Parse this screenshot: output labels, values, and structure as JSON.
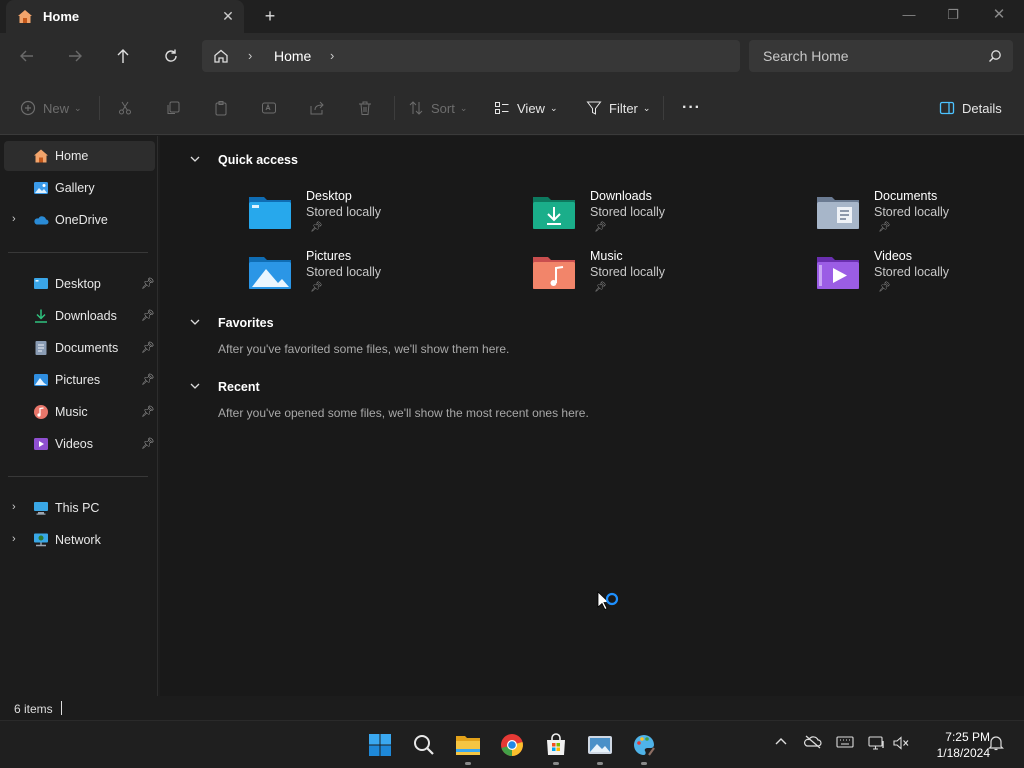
{
  "window": {
    "tab_title": "Home",
    "new_tab": "+"
  },
  "nav": {
    "breadcrumb": "Home",
    "search_placeholder": "Search Home"
  },
  "toolbar": {
    "new_label": "New",
    "sort_label": "Sort",
    "view_label": "View",
    "filter_label": "Filter",
    "more_label": "···",
    "details_label": "Details"
  },
  "sidebar": {
    "items": [
      {
        "label": "Home",
        "icon": "home-icon"
      },
      {
        "label": "Gallery",
        "icon": "gallery-icon"
      },
      {
        "label": "OneDrive",
        "icon": "onedrive-icon"
      },
      {
        "label": "Desktop",
        "icon": "desktop-icon"
      },
      {
        "label": "Downloads",
        "icon": "downloads-icon"
      },
      {
        "label": "Documents",
        "icon": "documents-icon"
      },
      {
        "label": "Pictures",
        "icon": "pictures-icon"
      },
      {
        "label": "Music",
        "icon": "music-icon"
      },
      {
        "label": "Videos",
        "icon": "videos-icon"
      },
      {
        "label": "This PC",
        "icon": "this-pc-icon"
      },
      {
        "label": "Network",
        "icon": "network-icon"
      }
    ]
  },
  "main": {
    "quick_access_title": "Quick access",
    "quick_access": [
      {
        "name": "Desktop",
        "sub": "Stored locally"
      },
      {
        "name": "Downloads",
        "sub": "Stored locally"
      },
      {
        "name": "Documents",
        "sub": "Stored locally"
      },
      {
        "name": "Pictures",
        "sub": "Stored locally"
      },
      {
        "name": "Music",
        "sub": "Stored locally"
      },
      {
        "name": "Videos",
        "sub": "Stored locally"
      }
    ],
    "favorites_title": "Favorites",
    "favorites_empty": "After you've favorited some files, we'll show them here.",
    "recent_title": "Recent",
    "recent_empty": "After you've opened some files, we'll show the most recent ones here."
  },
  "status": {
    "item_count": "6 items"
  },
  "taskbar": {
    "time": "7:25 PM",
    "date": "1/18/2024"
  },
  "colors": {
    "accent": "#4cc2ff",
    "folder_blue": "#1f8fe0",
    "downloads_green": "#16a085",
    "music_orange": "#f07a5a",
    "videos_purple": "#9b59d0"
  }
}
